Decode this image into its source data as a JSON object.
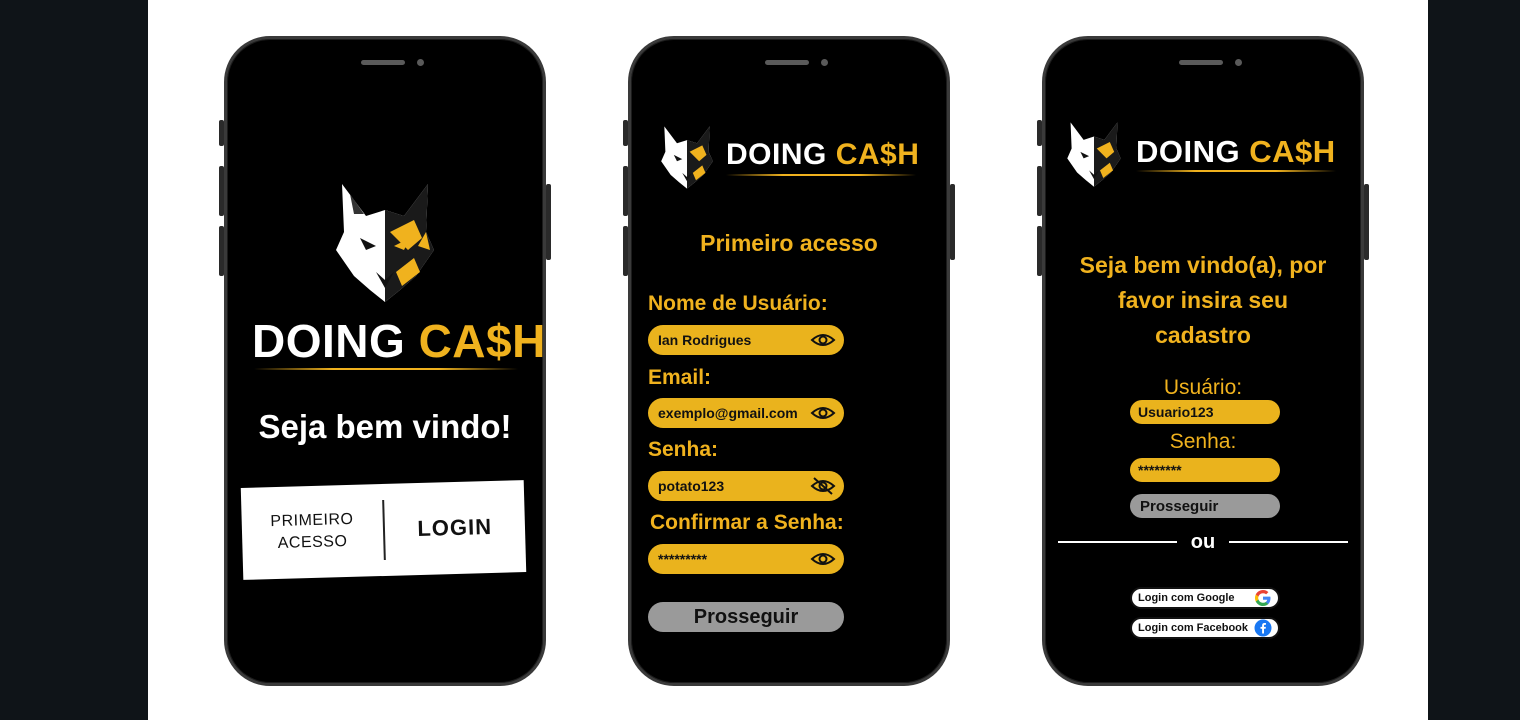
{
  "brand": {
    "doing": "DOING",
    "cash": "CA$H"
  },
  "screen1": {
    "welcome": "Seja bem vindo!",
    "first_access": "PRIMEIRO ACESSO",
    "login": "LOGIN"
  },
  "screen2": {
    "title": "Primeiro acesso",
    "username_label": "Nome de Usuário:",
    "username_value": "Ian Rodrigues",
    "email_label": "Email:",
    "email_value": "exemplo@gmail.com",
    "password_label": "Senha:",
    "password_value": "potato123",
    "confirm_label": "Confirmar a Senha:",
    "confirm_value": "*********",
    "continue": "Prosseguir"
  },
  "screen3": {
    "welcome_line1": "Seja bem vindo(a), por",
    "welcome_line2": "favor insira seu",
    "welcome_line3": "cadastro",
    "user_label": "Usuário:",
    "user_value": "Usuario123",
    "password_label": "Senha:",
    "password_value": "********",
    "continue": "Prosseguir",
    "or": "ou",
    "google": "Login com Google",
    "facebook": "Login com Facebook"
  },
  "colors": {
    "accent": "#f0b21e",
    "field": "#eab31d",
    "button_grey": "#9a9a9a"
  },
  "icons": [
    "wolf-logo",
    "eye-icon",
    "eye-off-icon",
    "google-icon",
    "facebook-icon"
  ]
}
